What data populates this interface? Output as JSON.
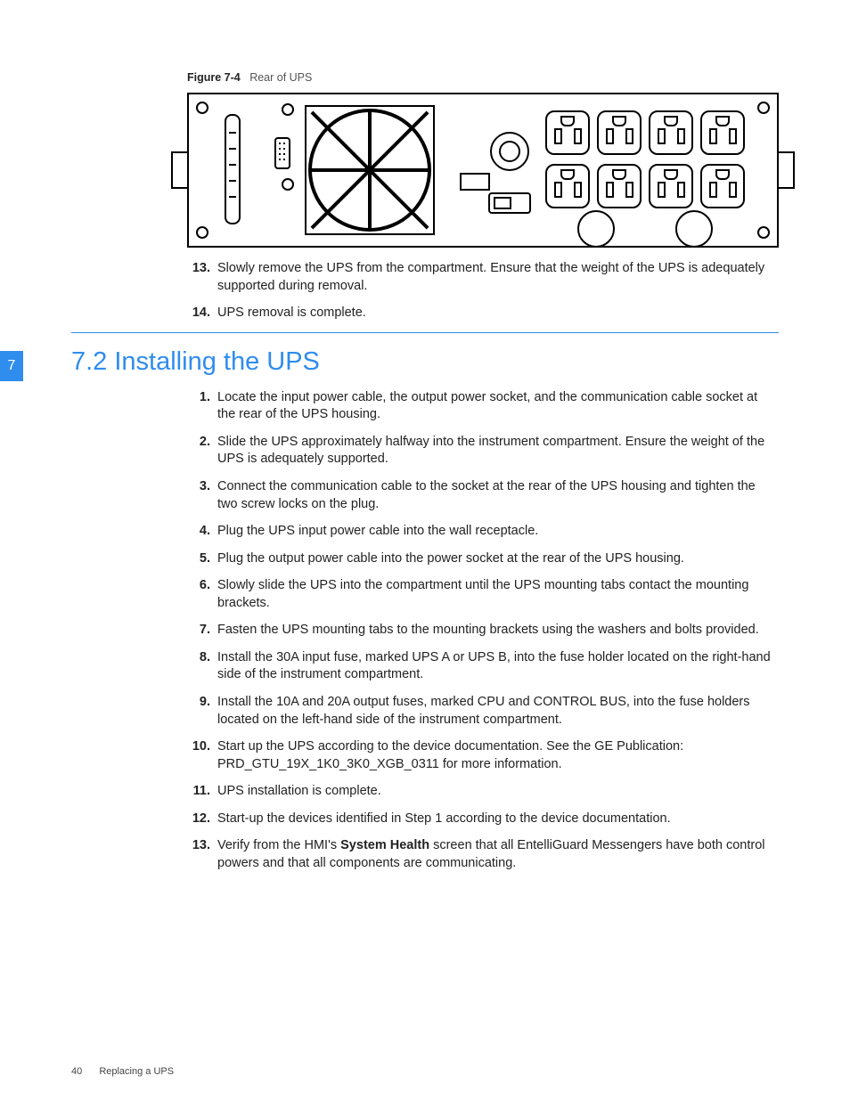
{
  "figure": {
    "label": "Figure 7-4",
    "title": "Rear of UPS"
  },
  "sideTab": "7",
  "removalSteps": [
    {
      "n": "13.",
      "text": "Slowly remove the UPS from the compartment. Ensure that the weight of the UPS is adequately supported during removal."
    },
    {
      "n": "14.",
      "text": "UPS removal is complete."
    }
  ],
  "sectionHeading": "7.2 Installing the UPS",
  "installSteps": [
    {
      "n": "1.",
      "text": "Locate the input power cable, the output power socket, and the communication cable socket at the rear of the UPS housing."
    },
    {
      "n": "2.",
      "text": "Slide the UPS approximately halfway into the instrument compartment. Ensure the weight of the UPS is adequately supported."
    },
    {
      "n": "3.",
      "text": "Connect the communication cable to the socket at the rear of the UPS housing and tighten the two screw locks on the plug."
    },
    {
      "n": "4.",
      "text": "Plug the UPS input power cable into the wall receptacle."
    },
    {
      "n": "5.",
      "text": "Plug the output power cable into the power socket at the rear of the UPS housing."
    },
    {
      "n": "6.",
      "text": "Slowly slide the UPS into the compartment until the UPS mounting tabs contact the mounting brackets."
    },
    {
      "n": "7.",
      "text": "Fasten the UPS mounting tabs to the mounting brackets using the washers and bolts provided."
    },
    {
      "n": "8.",
      "text": "Install the 30A input fuse, marked UPS A or UPS B, into the fuse holder located on the right-hand side of the instrument compartment."
    },
    {
      "n": "9.",
      "text": "Install the 10A and 20A output fuses, marked CPU and CONTROL BUS, into the fuse holders located on the left-hand side of the instrument compartment."
    },
    {
      "n": "10.",
      "text": "Start up the UPS according to the device documentation. See the GE Publication: PRD_GTU_19X_1K0_3K0_XGB_0311 for more information."
    },
    {
      "n": "11.",
      "text": "UPS installation is complete."
    },
    {
      "n": "12.",
      "text": "Start-up the devices identified in Step 1 according to the device documentation."
    }
  ],
  "installStep13": {
    "n": "13.",
    "pre": "Verify from the HMI's ",
    "bold": "System Health",
    "post": " screen that all EntelliGuard Messengers have both control powers and that all components are communicating."
  },
  "footer": {
    "pageNum": "40",
    "title": "Replacing a UPS"
  }
}
